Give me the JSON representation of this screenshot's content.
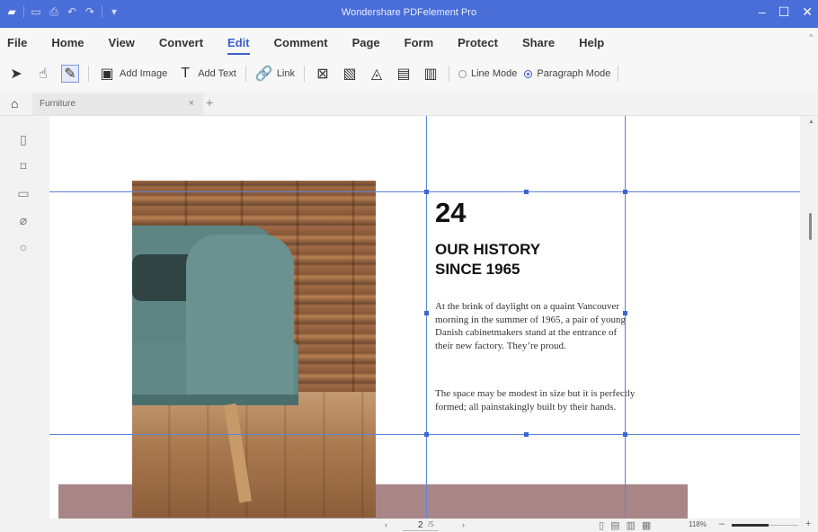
{
  "window": {
    "title": "Wondershare PDFelement Pro",
    "controls": [
      "–",
      "☐",
      "✕"
    ]
  },
  "quick_access": [
    "logo-icon",
    "save-icon",
    "print-icon",
    "undo-icon",
    "redo-icon",
    "customize-icon"
  ],
  "menu": {
    "items": [
      "File",
      "Home",
      "View",
      "Convert",
      "Edit",
      "Comment",
      "Page",
      "Form",
      "Protect",
      "Share",
      "Help"
    ],
    "active": "Edit"
  },
  "toolbar": {
    "add_image": "Add Image",
    "add_text": "Add Text",
    "link": "Link",
    "line_mode": "Line Mode",
    "paragraph_mode": "Paragraph Mode",
    "selected_mode": "Paragraph Mode"
  },
  "tabs": {
    "current": "Furniture"
  },
  "document": {
    "number": "24",
    "heading_line1": "OUR HISTORY",
    "heading_line2": "SINCE 1965",
    "paragraph1": "At the brink of daylight on a quaint Vancouver morning in the summer of 1965, a pair of young Danish cabinetmakers stand at the entrance of their new factory. They’re proud.",
    "paragraph2": "The space may be modest in size but it is perfectly formed; all painstakingly built by their hands."
  },
  "status": {
    "page_current": "2",
    "page_total": "/5",
    "zoom": "118%",
    "zoom_level": 0.55
  },
  "colors": {
    "accent": "#4a6ed8",
    "guide": "#5b83d8",
    "band": "#a88687"
  }
}
